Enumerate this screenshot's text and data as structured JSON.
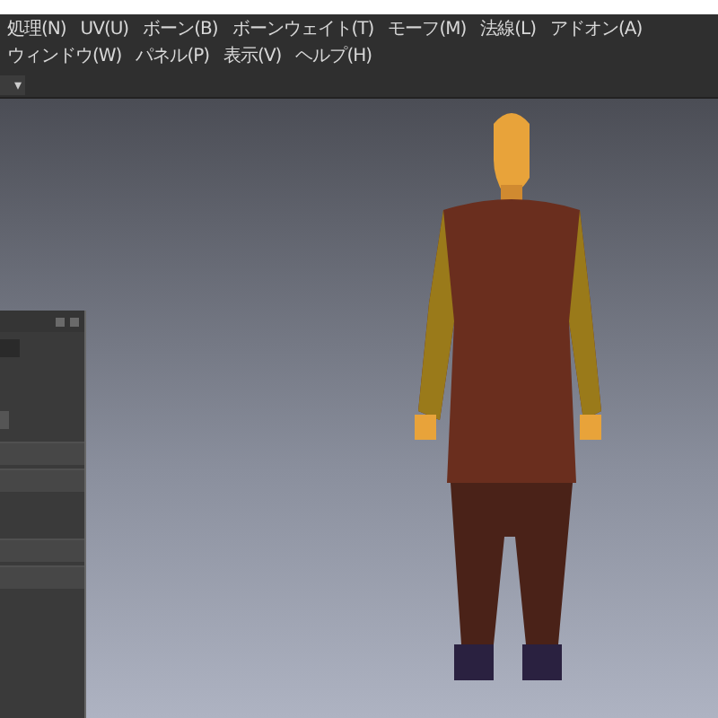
{
  "menu_bar": {
    "items": [
      "処理(N)",
      "UV(U)",
      "ボーン(B)",
      "ボーンウェイト(T)",
      "モーフ(M)",
      "法線(L)",
      "アドオン(A)",
      "ウィンドウ(W)",
      "パネル(P)",
      "表示(V)",
      "ヘルプ(H)"
    ]
  },
  "toolbar": {
    "dropdown_arrow": "▾"
  },
  "side_panel": {
    "rows": [
      {
        "kind": "field"
      },
      {
        "kind": "blank"
      },
      {
        "kind": "dropdown"
      },
      {
        "kind": "bar"
      },
      {
        "kind": "bar"
      },
      {
        "kind": "blank"
      },
      {
        "kind": "bar"
      },
      {
        "kind": "bar"
      }
    ]
  }
}
